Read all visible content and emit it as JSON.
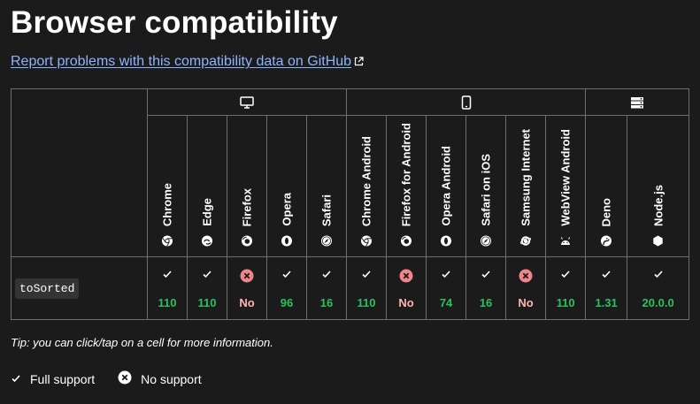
{
  "page": {
    "title": "Browser compatibility",
    "report_link": "Report problems with this compatibility data on GitHub",
    "tip": "Tip: you can click/tap on a cell for more information."
  },
  "groups": [
    {
      "name": "desktop",
      "icon": "desktop-icon",
      "span": 5
    },
    {
      "name": "mobile",
      "icon": "mobile-icon",
      "span": 6
    },
    {
      "name": "server",
      "icon": "server-icon",
      "span": 2
    }
  ],
  "browsers": [
    {
      "name": "Chrome",
      "icon": "chrome-icon"
    },
    {
      "name": "Edge",
      "icon": "edge-icon"
    },
    {
      "name": "Firefox",
      "icon": "firefox-icon"
    },
    {
      "name": "Opera",
      "icon": "opera-icon"
    },
    {
      "name": "Safari",
      "icon": "safari-icon"
    },
    {
      "name": "Chrome Android",
      "icon": "chrome-icon"
    },
    {
      "name": "Firefox for Android",
      "icon": "firefox-icon"
    },
    {
      "name": "Opera Android",
      "icon": "opera-icon"
    },
    {
      "name": "Safari on iOS",
      "icon": "safari-icon"
    },
    {
      "name": "Samsung Internet",
      "icon": "samsung-internet-icon"
    },
    {
      "name": "WebView Android",
      "icon": "android-icon"
    },
    {
      "name": "Deno",
      "icon": "deno-icon"
    },
    {
      "name": "Node.js",
      "icon": "nodejs-icon"
    }
  ],
  "feature": {
    "name": "toSorted",
    "support": [
      {
        "status": "yes",
        "version": "110"
      },
      {
        "status": "yes",
        "version": "110"
      },
      {
        "status": "no",
        "version": "No"
      },
      {
        "status": "yes",
        "version": "96"
      },
      {
        "status": "yes",
        "version": "16"
      },
      {
        "status": "yes",
        "version": "110"
      },
      {
        "status": "no",
        "version": "No"
      },
      {
        "status": "yes",
        "version": "74"
      },
      {
        "status": "yes",
        "version": "16"
      },
      {
        "status": "no",
        "version": "No"
      },
      {
        "status": "yes",
        "version": "110"
      },
      {
        "status": "yes",
        "version": "1.31"
      },
      {
        "status": "yes",
        "version": "20.0.0"
      }
    ]
  },
  "legend": {
    "full_support": "Full support",
    "no_support": "No support"
  },
  "colors": {
    "background": "#1b1b1b",
    "link": "#8cb4ff",
    "supported_text": "#2bc15e",
    "unsupported_text": "#ffb4ae",
    "unsupported_icon": "#f0868a",
    "border": "#6e6e6e"
  }
}
